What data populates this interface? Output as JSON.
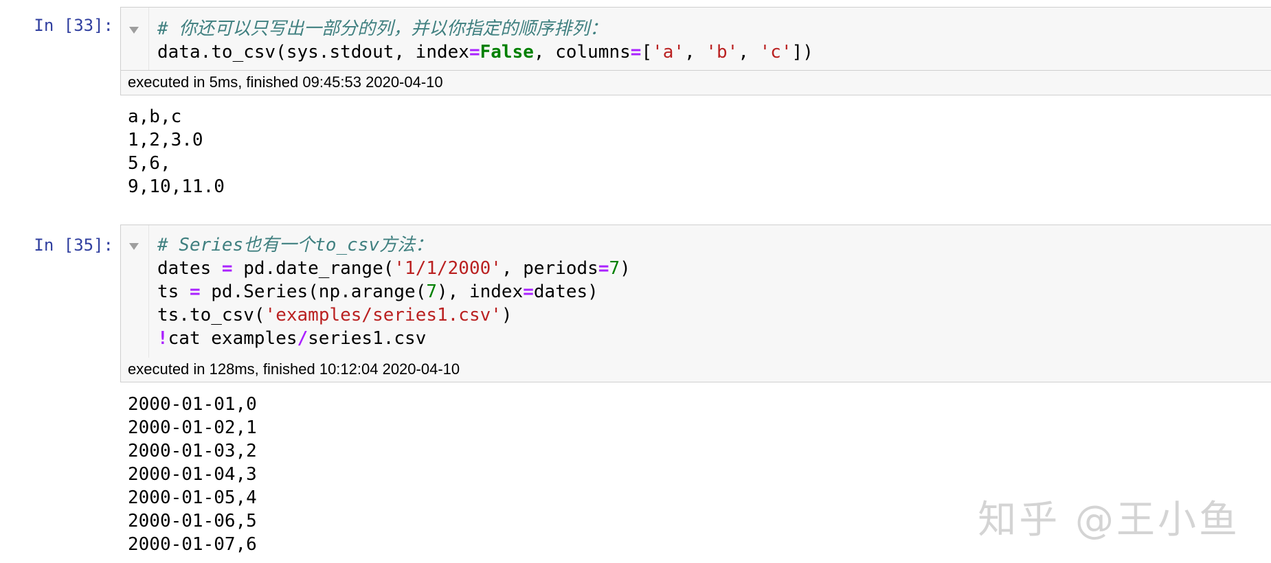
{
  "cells": [
    {
      "prompt": "In [33]:",
      "code_lines": [
        [
          {
            "t": "# 你还可以只写出一部分的列，并以你指定的顺序排列：",
            "c": "cm"
          }
        ],
        [
          {
            "t": "data.to_csv(sys.stdout, index",
            "c": ""
          },
          {
            "t": "=",
            "c": "op"
          },
          {
            "t": "False",
            "c": "kw"
          },
          {
            "t": ", columns",
            "c": ""
          },
          {
            "t": "=",
            "c": "op"
          },
          {
            "t": "[",
            "c": ""
          },
          {
            "t": "'a'",
            "c": "str"
          },
          {
            "t": ", ",
            "c": ""
          },
          {
            "t": "'b'",
            "c": "str"
          },
          {
            "t": ", ",
            "c": ""
          },
          {
            "t": "'c'",
            "c": "str"
          },
          {
            "t": "])",
            "c": ""
          }
        ]
      ],
      "exec_info": "executed in 5ms, finished 09:45:53 2020-04-10",
      "output_lines": [
        "a,b,c",
        "1,2,3.0",
        "5,6,",
        "9,10,11.0"
      ]
    },
    {
      "prompt": "In [35]:",
      "code_lines": [
        [
          {
            "t": "# Series也有一个to_csv方法：",
            "c": "cm"
          }
        ],
        [
          {
            "t": "dates ",
            "c": ""
          },
          {
            "t": "=",
            "c": "op"
          },
          {
            "t": " pd.date_range(",
            "c": ""
          },
          {
            "t": "'1/1/2000'",
            "c": "str"
          },
          {
            "t": ", periods",
            "c": ""
          },
          {
            "t": "=",
            "c": "op"
          },
          {
            "t": "7",
            "c": "num"
          },
          {
            "t": ")",
            "c": ""
          }
        ],
        [
          {
            "t": "ts ",
            "c": ""
          },
          {
            "t": "=",
            "c": "op"
          },
          {
            "t": " pd.Series(np.arange(",
            "c": ""
          },
          {
            "t": "7",
            "c": "num"
          },
          {
            "t": "), index",
            "c": ""
          },
          {
            "t": "=",
            "c": "op"
          },
          {
            "t": "dates)",
            "c": ""
          }
        ],
        [
          {
            "t": "ts.to_csv(",
            "c": ""
          },
          {
            "t": "'examples/series1.csv'",
            "c": "str"
          },
          {
            "t": ")",
            "c": ""
          }
        ],
        [
          {
            "t": "!",
            "c": "op"
          },
          {
            "t": "cat examples",
            "c": ""
          },
          {
            "t": "/",
            "c": "op"
          },
          {
            "t": "series1.csv",
            "c": ""
          }
        ]
      ],
      "exec_info": "executed in 128ms, finished 10:12:04 2020-04-10",
      "output_lines": [
        "2000-01-01,0",
        "2000-01-02,1",
        "2000-01-03,2",
        "2000-01-04,3",
        "2000-01-05,4",
        "2000-01-06,5",
        "2000-01-07,6"
      ]
    }
  ],
  "watermark": "知乎 @王小鱼"
}
